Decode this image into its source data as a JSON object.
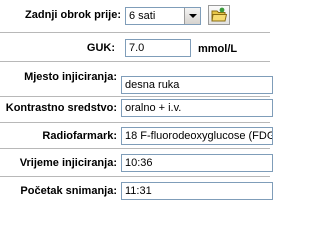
{
  "form": {
    "last_meal": {
      "label": "Zadnji obrok prije:",
      "value": "6 sati"
    },
    "guk": {
      "label": "GUK:",
      "value": "7.0",
      "unit": "mmol/L"
    },
    "injection_site": {
      "label": "Mjesto injiciranja:",
      "value": "desna ruka"
    },
    "contrast": {
      "label": "Kontrastno sredstvo:",
      "value": "oralno +  i.v."
    },
    "radiopharm": {
      "label": "Radiofarmark:",
      "value": "18 F-fluorodeoxyglucose (FDG"
    },
    "injection_time": {
      "label": "Vrijeme injiciranja:",
      "value": "10:36"
    },
    "scan_start": {
      "label": "Početak snimanja:",
      "value": "11:31"
    }
  },
  "icons": {
    "folder_button": "folder-icon"
  }
}
